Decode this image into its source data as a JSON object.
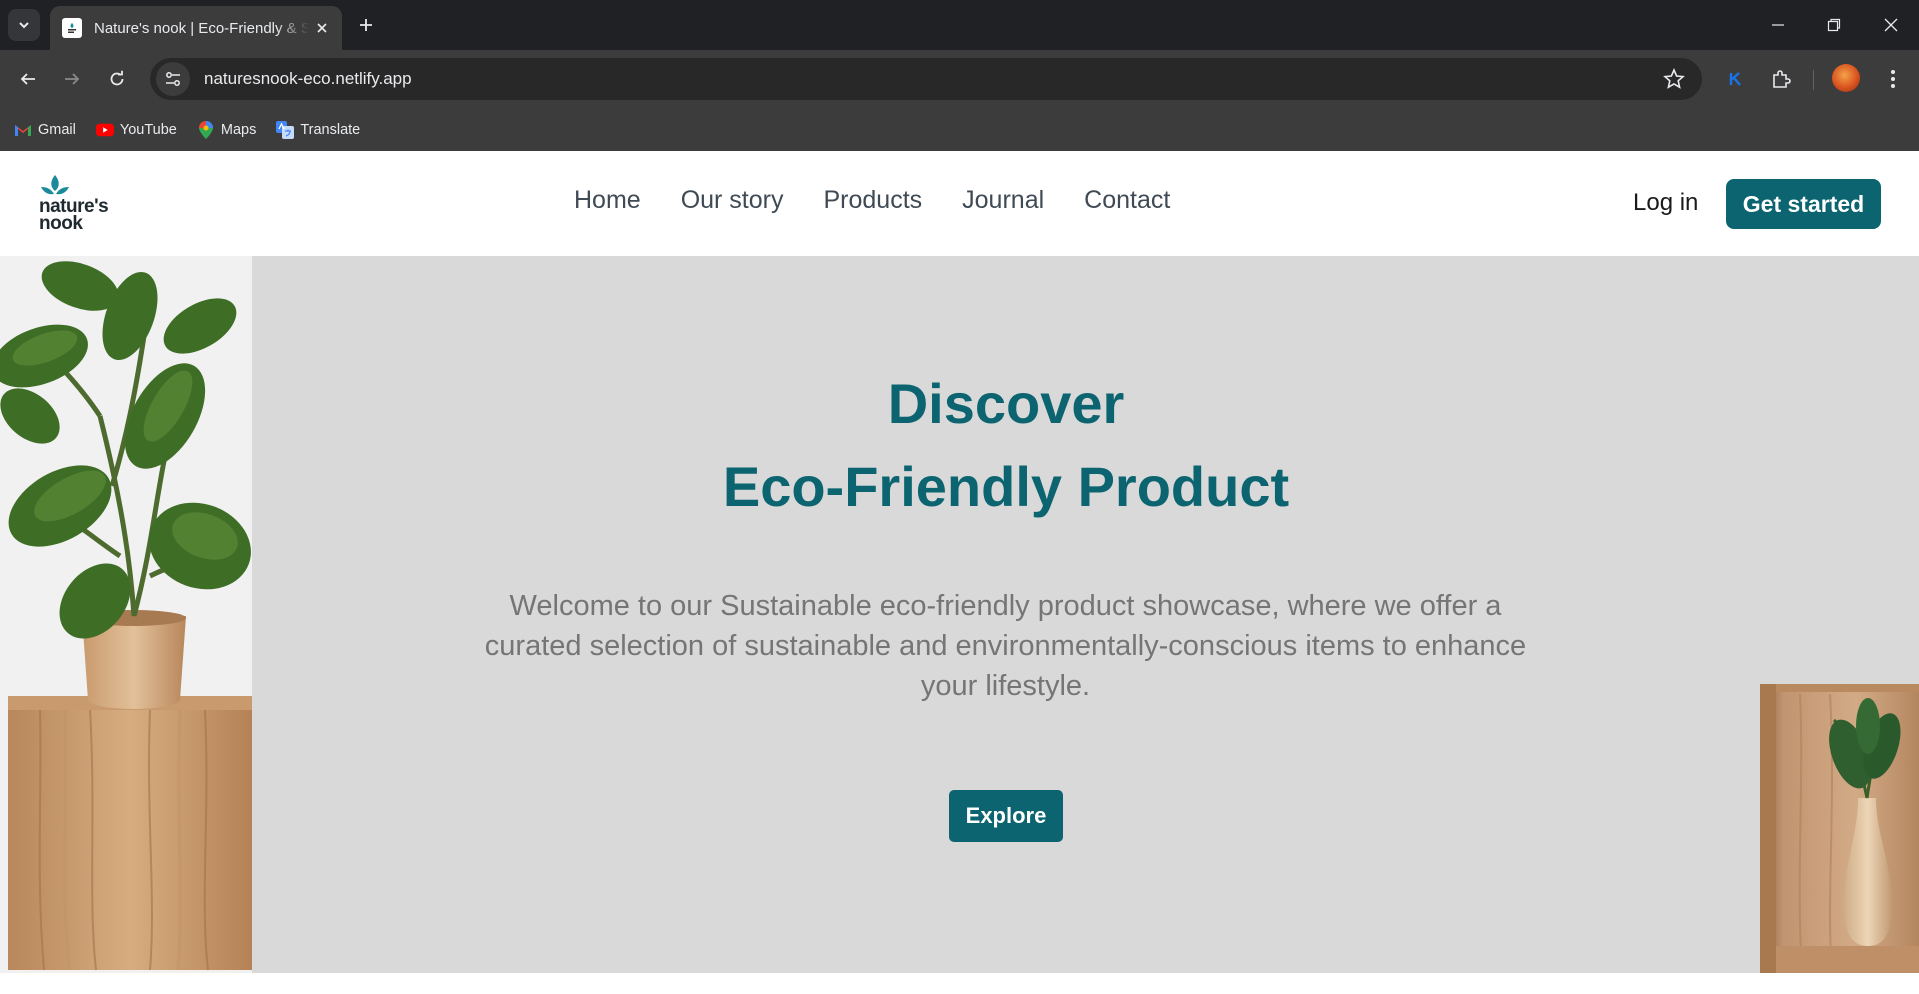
{
  "browser": {
    "tab_title": "Nature's nook | Eco-Friendly & Sustainable",
    "url": "naturesnook-eco.netlify.app",
    "bookmarks": [
      {
        "label": "Gmail",
        "icon": "gmail-icon"
      },
      {
        "label": "YouTube",
        "icon": "youtube-icon"
      },
      {
        "label": "Maps",
        "icon": "maps-icon"
      },
      {
        "label": "Translate",
        "icon": "translate-icon"
      }
    ]
  },
  "site": {
    "logo_line1": "nature's",
    "logo_line2": "nook",
    "nav": [
      "Home",
      "Our story",
      "Products",
      "Journal",
      "Contact"
    ],
    "login_label": "Log in",
    "cta_label": "Get started"
  },
  "hero": {
    "title_line1": "Discover",
    "title_line2": "Eco-Friendly Product",
    "description": "Welcome to our Sustainable eco-friendly product showcase, where we offer a curated selection of sustainable and environmentally-conscious items to enhance your lifestyle.",
    "button_label": "Explore"
  },
  "colors": {
    "brand": "#0b6470",
    "hero_bg": "#d9d9d9",
    "chrome_dark": "#202124",
    "chrome_toolbar": "#3c3c3c"
  }
}
